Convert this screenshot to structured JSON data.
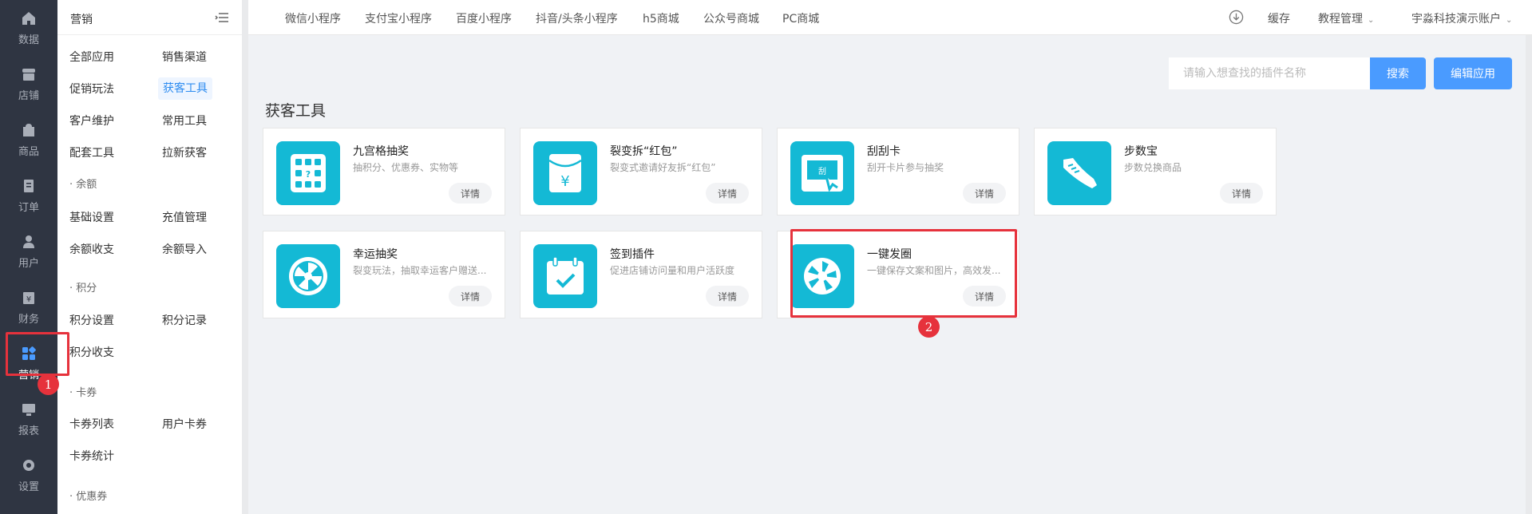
{
  "rail": {
    "items": [
      {
        "label": "数据",
        "icon": "home-icon"
      },
      {
        "label": "店铺",
        "icon": "store-icon"
      },
      {
        "label": "商品",
        "icon": "bag-icon"
      },
      {
        "label": "订单",
        "icon": "order-icon"
      },
      {
        "label": "用户",
        "icon": "user-icon"
      },
      {
        "label": "财务",
        "icon": "finance-icon"
      },
      {
        "label": "营销",
        "icon": "marketing-icon"
      },
      {
        "label": "报表",
        "icon": "report-icon"
      },
      {
        "label": "设置",
        "icon": "gear-icon"
      }
    ],
    "active": "营销"
  },
  "subnav": {
    "title": "营销",
    "items": {
      "all_apps": "全部应用",
      "sales_channel": "销售渠道",
      "promo": "促销玩法",
      "acquisition": "获客工具",
      "customer": "客户维护",
      "common": "常用工具",
      "support": "配套工具",
      "pull_new": "拉新获客",
      "group_balance": "· 余额",
      "balance_settings": "基础设置",
      "recharge": "充值管理",
      "balance_flow": "余额收支",
      "balance_import": "余额导入",
      "group_points": "· 积分",
      "points_settings": "积分设置",
      "points_record": "积分记录",
      "points_flow": "积分收支",
      "group_coupon_card": "· 卡券",
      "card_list": "卡券列表",
      "user_card": "用户卡券",
      "card_stats": "卡券统计",
      "group_discount": "· 优惠券"
    }
  },
  "topbar": {
    "tabs": [
      "微信小程序",
      "支付宝小程序",
      "百度小程序",
      "抖音/头条小程序",
      "h5商城",
      "公众号商城",
      "PC商城"
    ],
    "cache": "缓存",
    "tutorial": "教程管理",
    "account": "宇淼科技演示账户"
  },
  "search": {
    "placeholder": "请输入想查找的插件名称",
    "search_btn": "搜索",
    "edit_btn": "编辑应用"
  },
  "section_title": "获客工具",
  "cards": [
    {
      "name": "九宫格抽奖",
      "desc": "抽积分、优惠券、实物等",
      "btn": "详情",
      "icon": "grid-lottery-icon"
    },
    {
      "name": "裂变拆“红包”",
      "desc": "裂变式邀请好友拆“红包”",
      "btn": "详情",
      "icon": "red-envelope-icon"
    },
    {
      "name": "刮刮卡",
      "desc": "刮开卡片参与抽奖",
      "btn": "详情",
      "icon": "scratch-card-icon"
    },
    {
      "name": "步数宝",
      "desc": "步数兑换商品",
      "btn": "详情",
      "icon": "sneaker-icon"
    },
    {
      "name": "幸运抽奖",
      "desc": "裂变玩法，抽取幸运客户赠送...",
      "btn": "详情",
      "icon": "wheel-icon"
    },
    {
      "name": "签到插件",
      "desc": "促进店铺访问量和用户活跃度",
      "btn": "详情",
      "icon": "calendar-check-icon"
    },
    {
      "name": "一键发圈",
      "desc": "一键保存文案和图片，高效发...",
      "btn": "详情",
      "icon": "aperture-icon"
    }
  ],
  "annotations": [
    "1",
    "2"
  ],
  "colors": {
    "accent": "#4a9bff",
    "icon_bg": "#14b9d5",
    "annotation": "#e6323c",
    "rail": "#2f3542"
  }
}
